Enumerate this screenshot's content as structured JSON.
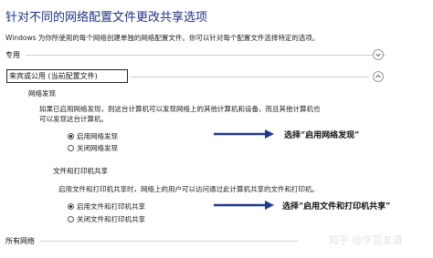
{
  "page": {
    "title": "针对不同的网络配置文件更改共享选项",
    "description": "Windows 为你所使用的每个网络创建单独的网络配置文件。你可以针对每个配置文件选择特定的选项。"
  },
  "profiles": {
    "private_label": "专用",
    "guest_label": "来宾或公用 (当前配置文件)",
    "all_networks_label": "所有网络"
  },
  "network_discovery": {
    "heading": "网络发现",
    "text_line1": "如果已启用网络发现，则这台计算机可以发现网络上的其他计算机和设备，而且其他计算机也",
    "text_line2": "可以发现这台计算机。",
    "options": [
      {
        "label": "启用网络发现",
        "selected": true
      },
      {
        "label": "关闭网络发现",
        "selected": false
      }
    ]
  },
  "file_printer_sharing": {
    "heading": "文件和打印机共享",
    "text_line1": "启用文件和打印机共享时，网络上的用户可以访问通过此计算机共享的文件和打印机。",
    "options": [
      {
        "label": "启用文件和打印机共享",
        "selected": true
      },
      {
        "label": "关闭文件和打印机共享",
        "selected": false
      }
    ]
  },
  "annotations": {
    "discovery_callout": "选择“启用网络发现”",
    "sharing_callout": "选择“启用文件和打印机共享”"
  },
  "watermark": "知乎 @华芸友道",
  "colors": {
    "title": "#1e3287",
    "arrow": "#1f3a8a"
  }
}
